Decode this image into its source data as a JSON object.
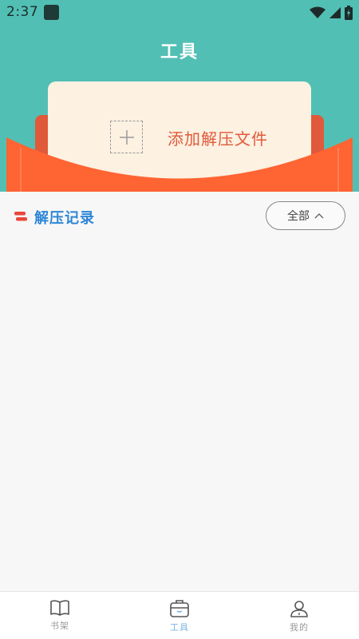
{
  "status_bar": {
    "time": "2:37"
  },
  "header": {
    "title": "工具"
  },
  "card": {
    "add_label": "添加解压文件"
  },
  "section": {
    "title": "解压记录",
    "filter_label": "全部"
  },
  "nav": {
    "items": [
      {
        "label": "书架",
        "icon": "book-icon",
        "active": false
      },
      {
        "label": "工具",
        "icon": "toolbox-icon",
        "active": true
      },
      {
        "label": "我的",
        "icon": "person-icon",
        "active": false
      }
    ]
  },
  "colors": {
    "header_bg": "#52bfb4",
    "envelope": "#ff6433",
    "card_bg": "#fdf1e2",
    "accent_text": "#e0593a",
    "section_title": "#2e86d6",
    "nav_active": "#7fb3e6"
  }
}
